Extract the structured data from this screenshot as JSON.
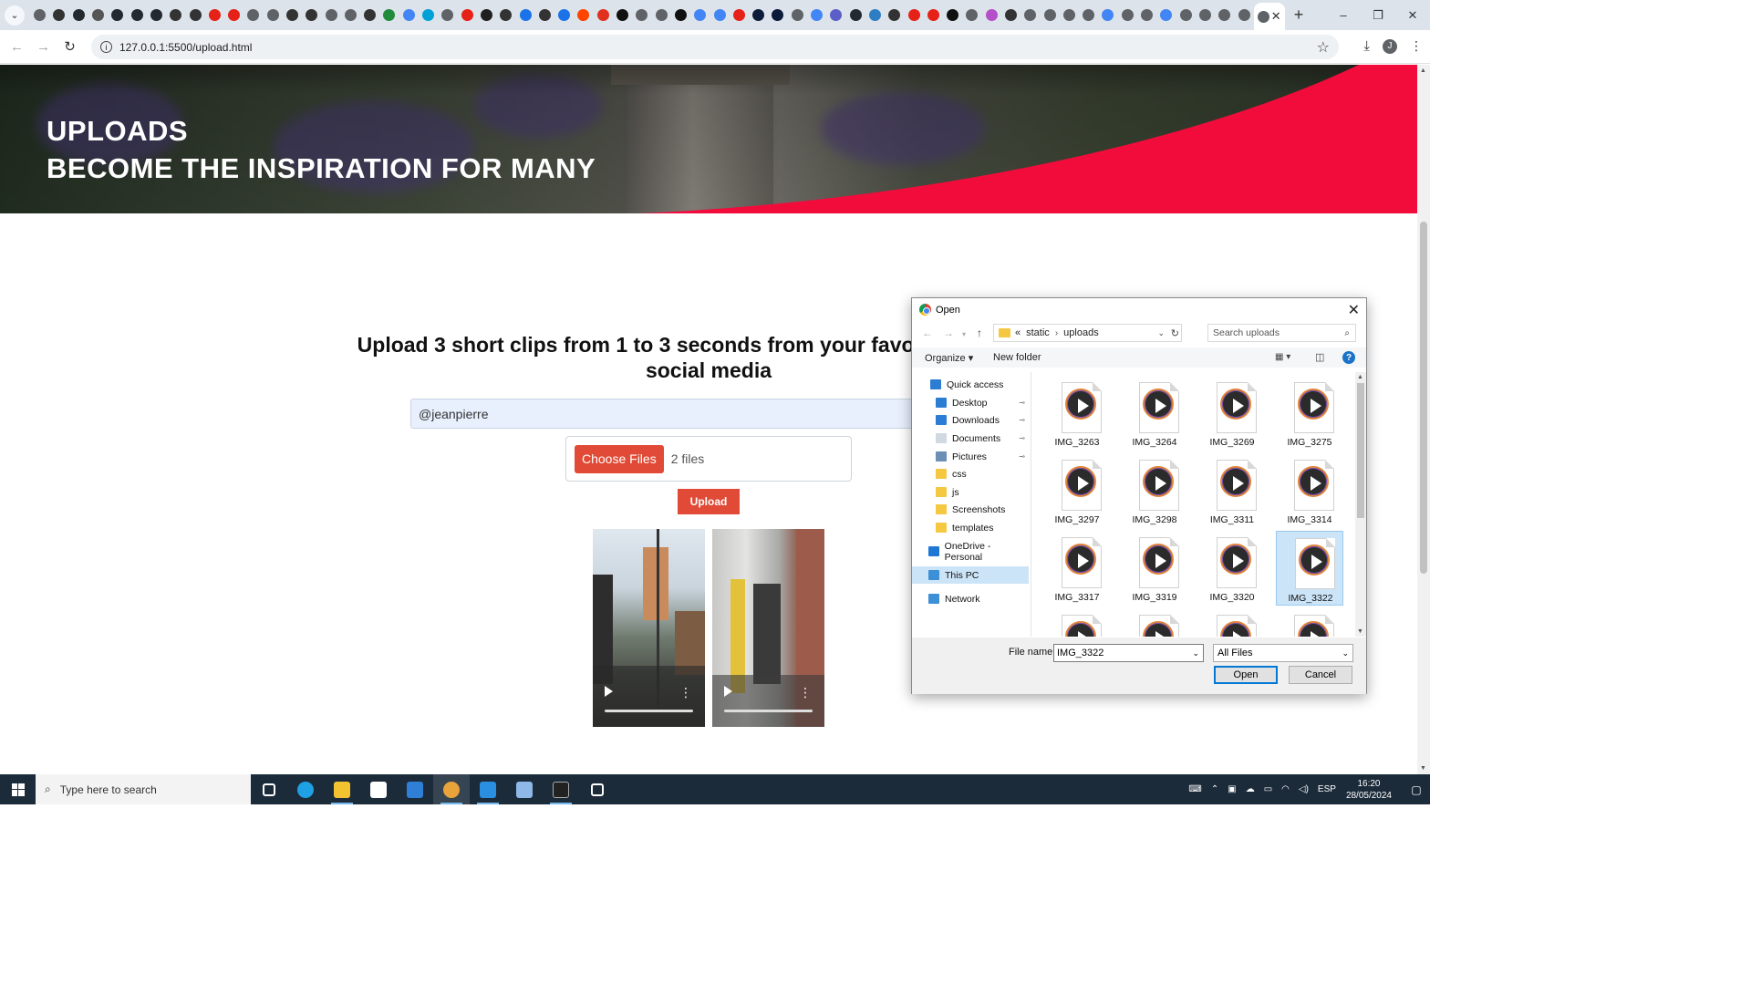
{
  "browser": {
    "tab_count_favicons": 63,
    "active_tab_close": "✕",
    "new_tab": "+",
    "window_controls": [
      "–",
      "❐",
      "✕"
    ],
    "url": "127.0.0.1:5500/upload.html"
  },
  "hero": {
    "line1": "UPLOADS",
    "line2": "BECOME THE INSPIRATION FOR MANY",
    "accent_color": "#f20c3c"
  },
  "main": {
    "heading_line1": "Upload 3 short clips from 1 to 3 seconds from your favorite place in Br",
    "heading_line2": "social media",
    "handle_value": "@jeanpierre",
    "choose_files_label": "Choose Files",
    "file_count": "2 files",
    "upload_label": "Upload",
    "accent_color": "#e04a36"
  },
  "dialog": {
    "title": "Open",
    "breadcrumb_prefix": "«",
    "breadcrumb": [
      "static",
      "uploads"
    ],
    "search_placeholder": "Search uploads",
    "organize": "Organize ▾",
    "new_folder": "New folder",
    "help": "?",
    "nav_items": [
      {
        "label": "Quick access",
        "icon": "star-icon",
        "pinned": false
      },
      {
        "label": "Desktop",
        "icon": "desktop-icon",
        "pinned": true
      },
      {
        "label": "Downloads",
        "icon": "download-icon",
        "pinned": true
      },
      {
        "label": "Documents",
        "icon": "document-icon",
        "pinned": true
      },
      {
        "label": "Pictures",
        "icon": "pictures-icon",
        "pinned": true
      },
      {
        "label": "css",
        "icon": "folder-icon",
        "pinned": false
      },
      {
        "label": "js",
        "icon": "folder-icon",
        "pinned": false
      },
      {
        "label": "Screenshots",
        "icon": "folder-icon",
        "pinned": false
      },
      {
        "label": "templates",
        "icon": "folder-icon",
        "pinned": false
      },
      {
        "label": "OneDrive - Personal",
        "icon": "cloud-icon",
        "pinned": false
      },
      {
        "label": "This PC",
        "icon": "computer-icon",
        "pinned": false
      },
      {
        "label": "Network",
        "icon": "network-icon",
        "pinned": false
      }
    ],
    "selected_nav": "This PC",
    "files": [
      "IMG_3263",
      "IMG_3264",
      "IMG_3269",
      "IMG_3275",
      "IMG_3297",
      "IMG_3298",
      "IMG_3311",
      "IMG_3314",
      "IMG_3317",
      "IMG_3319",
      "IMG_3320",
      "IMG_3322",
      "",
      "",
      "",
      ""
    ],
    "selected_file": "IMG_3322",
    "file_name_label": "File name:",
    "file_name_value": "IMG_3322",
    "file_type": "All Files",
    "open_label": "Open",
    "cancel_label": "Cancel"
  },
  "taskbar": {
    "search_placeholder": "Type here to search",
    "apps": [
      "task-view-icon",
      "edge-icon",
      "file-explorer-icon",
      "store-icon",
      "mail-icon",
      "chrome-icon",
      "vscode-icon",
      "notepad-icon",
      "terminal-icon",
      "settings-icon"
    ],
    "active_app": "chrome-icon",
    "language": "ESP",
    "time": "16:20",
    "date": "28/05/2024"
  }
}
